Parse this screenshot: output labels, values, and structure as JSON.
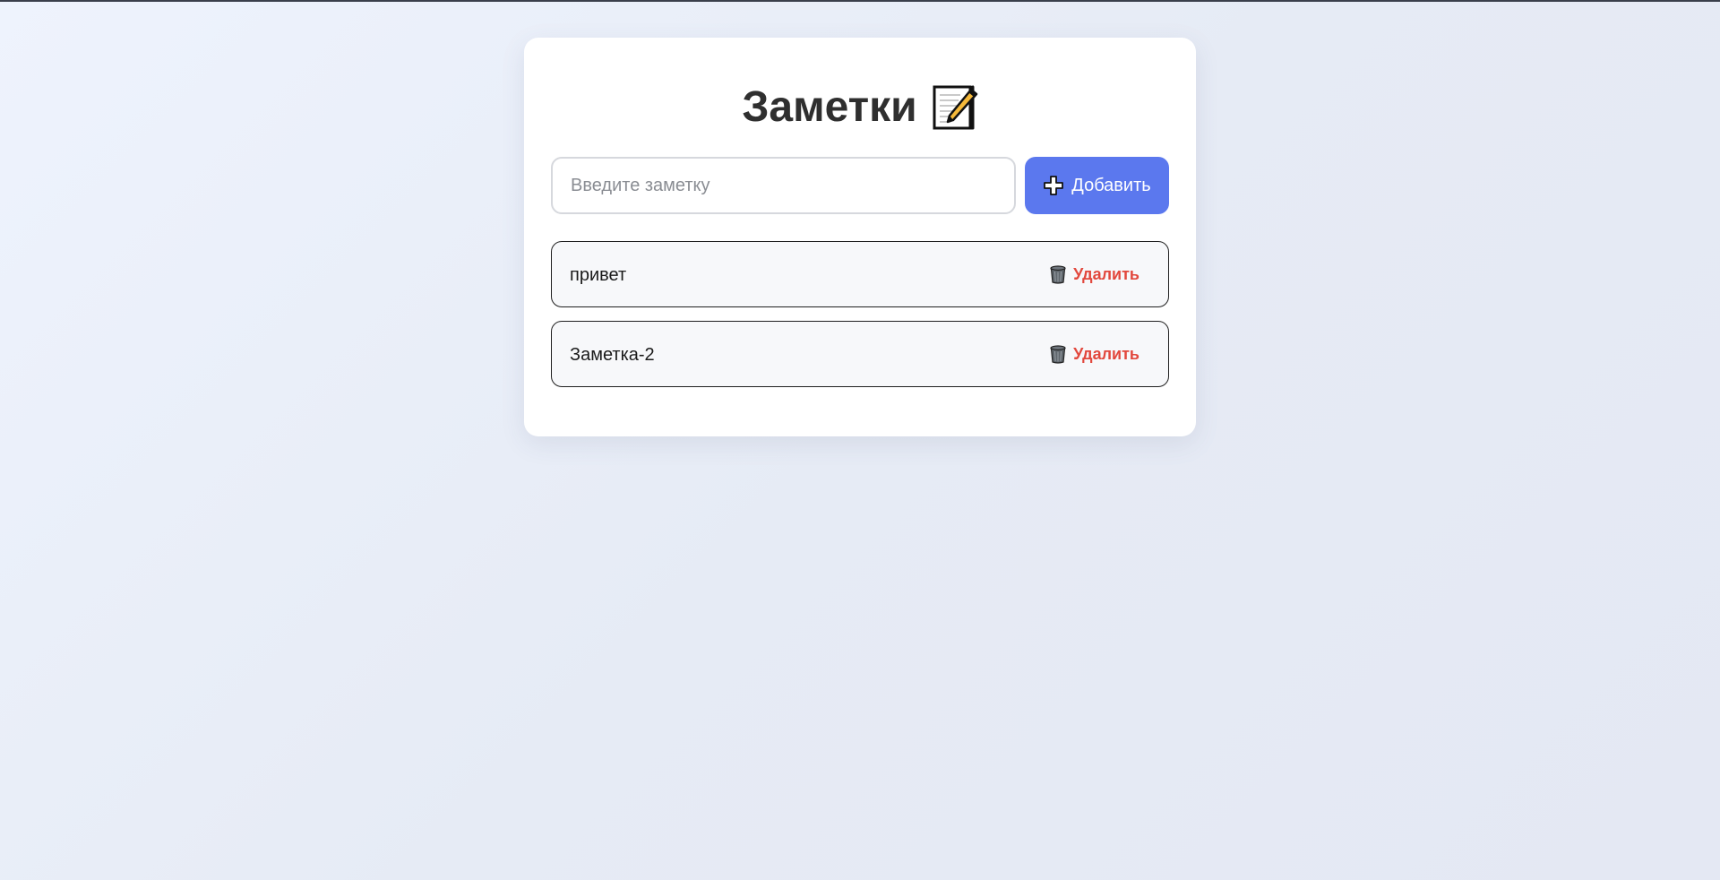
{
  "app": {
    "title": "Заметки",
    "title_icon": "memo-icon"
  },
  "input": {
    "placeholder": "Введите заметку",
    "value": ""
  },
  "add_button": {
    "label": "Добавить",
    "icon": "plus-icon",
    "color": "#5b78ee"
  },
  "notes": [
    {
      "text": "привет",
      "delete_label": "Удалить",
      "delete_icon": "trash-icon"
    },
    {
      "text": "Заметка-2",
      "delete_label": "Удалить",
      "delete_icon": "trash-icon"
    }
  ],
  "colors": {
    "accent": "#5b78ee",
    "danger": "#e2483d"
  }
}
